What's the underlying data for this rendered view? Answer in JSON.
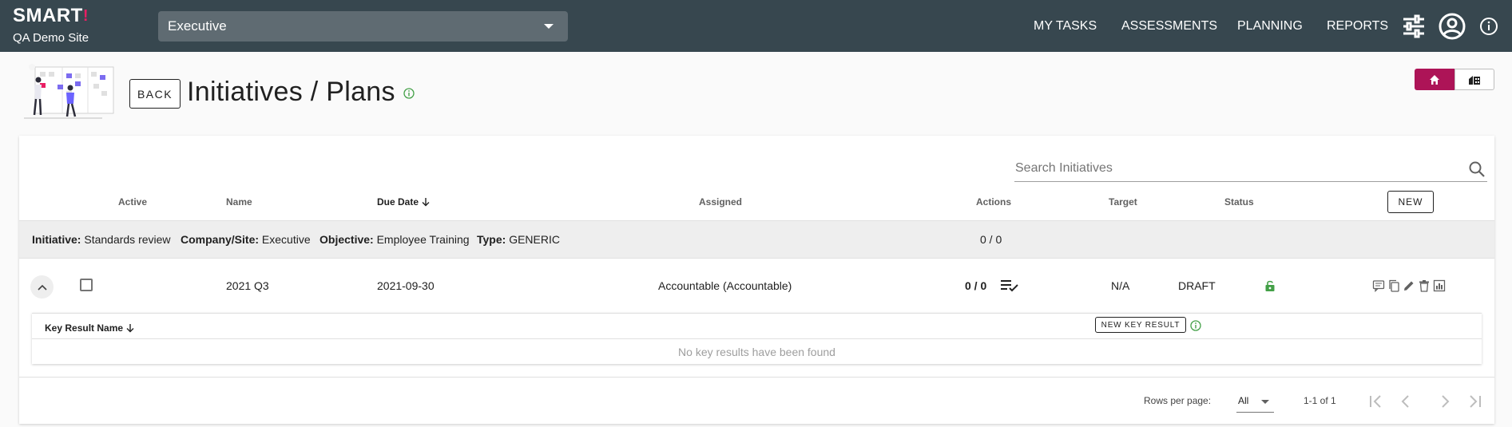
{
  "brand": {
    "logo": "SMART",
    "logo_mark": "!",
    "site_name": "QA Demo Site"
  },
  "site_select": {
    "value": "Executive"
  },
  "nav": {
    "items": [
      {
        "label": "MY TASKS"
      },
      {
        "label": "ASSESSMENTS"
      },
      {
        "label": "PLANNING"
      },
      {
        "label": "REPORTS"
      }
    ],
    "icons": [
      "sliders-icon",
      "account-circle-icon",
      "info-icon"
    ]
  },
  "header": {
    "back_label": "BACK",
    "title": "Initiatives / Plans"
  },
  "search": {
    "placeholder": "Search Initiatives"
  },
  "table": {
    "columns": {
      "active": "Active",
      "name": "Name",
      "due_date": "Due Date",
      "assigned": "Assigned",
      "actions": "Actions",
      "target": "Target",
      "status": "Status"
    },
    "new_label": "NEW",
    "group": {
      "initiative_label": "Initiative:",
      "initiative_value": "Standards review",
      "company_label": "Company/Site:",
      "company_value": "Executive",
      "objective_label": "Objective:",
      "objective_value": "Employee Training",
      "type_label": "Type:",
      "type_value": "GENERIC",
      "actions_count": "0 / 0"
    },
    "rows": [
      {
        "name": "2021 Q3",
        "due_date": "2021-09-30",
        "assigned": "Accountable (Accountable)",
        "actions": "0 / 0",
        "target": "N/A",
        "status": "DRAFT",
        "active": false,
        "expanded": true
      }
    ]
  },
  "key_results": {
    "column": "Key Result Name",
    "new_label": "NEW KEY RESULT",
    "empty_text": "No key results have been found"
  },
  "footer": {
    "rows_per_page_label": "Rows per page:",
    "rows_per_page_value": "All",
    "range": "1-1 of 1"
  },
  "colors": {
    "topbar": "#37474f",
    "accent": "#ad1457",
    "success": "#43a047"
  }
}
